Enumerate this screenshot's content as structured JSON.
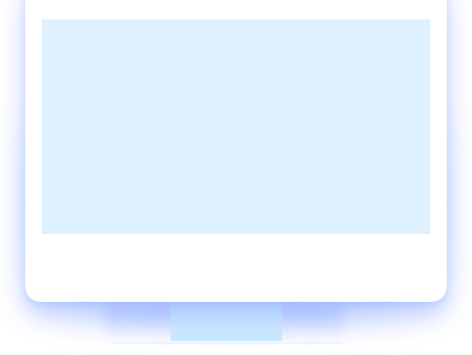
{
  "illustration": {
    "kind": "desktop-monitor",
    "colors": {
      "frame": "#ffffff",
      "screen": "#dff1ff",
      "stand": "#cde9ff",
      "glow": "#a8c0ff"
    }
  }
}
